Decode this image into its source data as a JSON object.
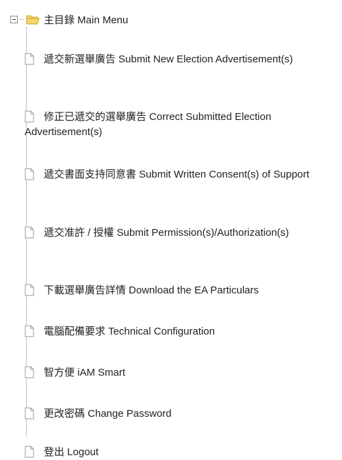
{
  "tree": {
    "root": {
      "label": "主目錄 Main Menu",
      "expanded": true
    },
    "items": [
      {
        "label": "遞交新選舉廣告 Submit New Election Advertisement(s)"
      },
      {
        "label": "修正已遞交的選舉廣告 Correct Submitted Election Advertisement(s)"
      },
      {
        "label": "遞交書面支持同意書 Submit Written Consent(s) of Support"
      },
      {
        "label": "遞交准許 / 授權 Submit Permission(s)/Authorization(s)"
      },
      {
        "label": "下載選舉廣告詳情 Download the EA Particulars"
      },
      {
        "label": "電腦配備要求 Technical Configuration"
      },
      {
        "label": "智方便 iAM Smart"
      },
      {
        "label": "更改密碼 Change Password"
      },
      {
        "label": "登出 Logout"
      }
    ]
  },
  "icons": {
    "root_expander": "collapse-minus-icon",
    "root_folder": "open-folder-icon",
    "item_page": "page-icon"
  },
  "colors": {
    "folder_fill": "#f7d66b",
    "folder_stroke": "#c9a227",
    "page_fill": "#ffffff",
    "page_stroke": "#9a9a9a",
    "connector": "#8a8a8a"
  }
}
